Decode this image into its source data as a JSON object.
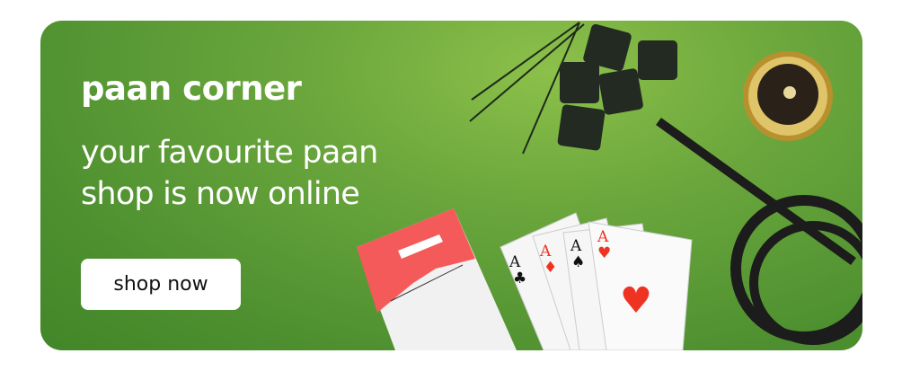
{
  "banner": {
    "title": "paan corner",
    "subtitle_line1": "your favourite paan",
    "subtitle_line2": "shop is now online",
    "cta_label": "shop now"
  },
  "colors": {
    "green": "#5a9a34",
    "red": "#f45a5a"
  },
  "cards": [
    {
      "rank": "A",
      "suit": "♣"
    },
    {
      "rank": "A",
      "suit": "♦"
    },
    {
      "rank": "A",
      "suit": "♠"
    },
    {
      "rank": "A",
      "suit": "♥"
    }
  ]
}
